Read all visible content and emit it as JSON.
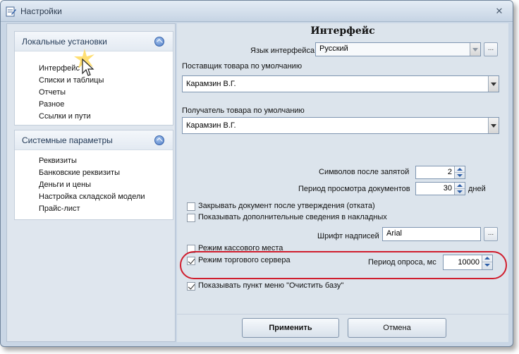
{
  "window": {
    "title": "Настройки"
  },
  "sidebar": {
    "groups": [
      {
        "title": "Локальные установки",
        "items": [
          "Интерфейс",
          "Списки и таблицы",
          "Отчеты",
          "Разное",
          "Ссылки и пути"
        ]
      },
      {
        "title": "Системные параметры",
        "items": [
          "Реквизиты",
          "Банковские реквизиты",
          "Деньги и цены",
          "Настройка складской модели",
          "Прайс-лист"
        ]
      }
    ]
  },
  "content": {
    "heading": "Интерфейс",
    "language": {
      "label": "Язык интерфейса",
      "value": "Русский"
    },
    "supplier": {
      "label": "Поставщик товара по умолчанию",
      "value": "Карамзин В.Г."
    },
    "recipient": {
      "label": "Получатель товара по умолчанию",
      "value": "Карамзин В.Г."
    },
    "decimals": {
      "label": "Символов после запятой",
      "value": "2"
    },
    "period": {
      "label": "Период просмотра документов",
      "value": "30",
      "unit": "дней"
    },
    "checkboxes": {
      "close_doc": {
        "label": "Закрывать документ после утверждения (отката)",
        "checked": false
      },
      "show_info": {
        "label": "Показывать дополнительные сведения в накладных",
        "checked": false
      },
      "cash_mode": {
        "label": "Режим кассового места",
        "checked": false
      },
      "server_mode": {
        "label": "Режим торгового сервера",
        "checked": true
      },
      "clear_db": {
        "label": "Показывать пункт меню \"Очистить базу\"",
        "checked": true
      }
    },
    "font": {
      "label": "Шрифт надписей",
      "value": "Arial"
    },
    "poll": {
      "label": "Период опроса, мс",
      "value": "10000"
    },
    "ellipsis": "..."
  },
  "footer": {
    "apply_label": "Применить",
    "cancel_label": "Отмена"
  },
  "icons": {
    "app": "settings-app-icon",
    "close": "close-icon",
    "collapse": "collapse-icon",
    "cursor": "mouse-cursor-icon"
  },
  "colors": {
    "highlight": "#d01e2e",
    "accent": "#4b79c4"
  }
}
